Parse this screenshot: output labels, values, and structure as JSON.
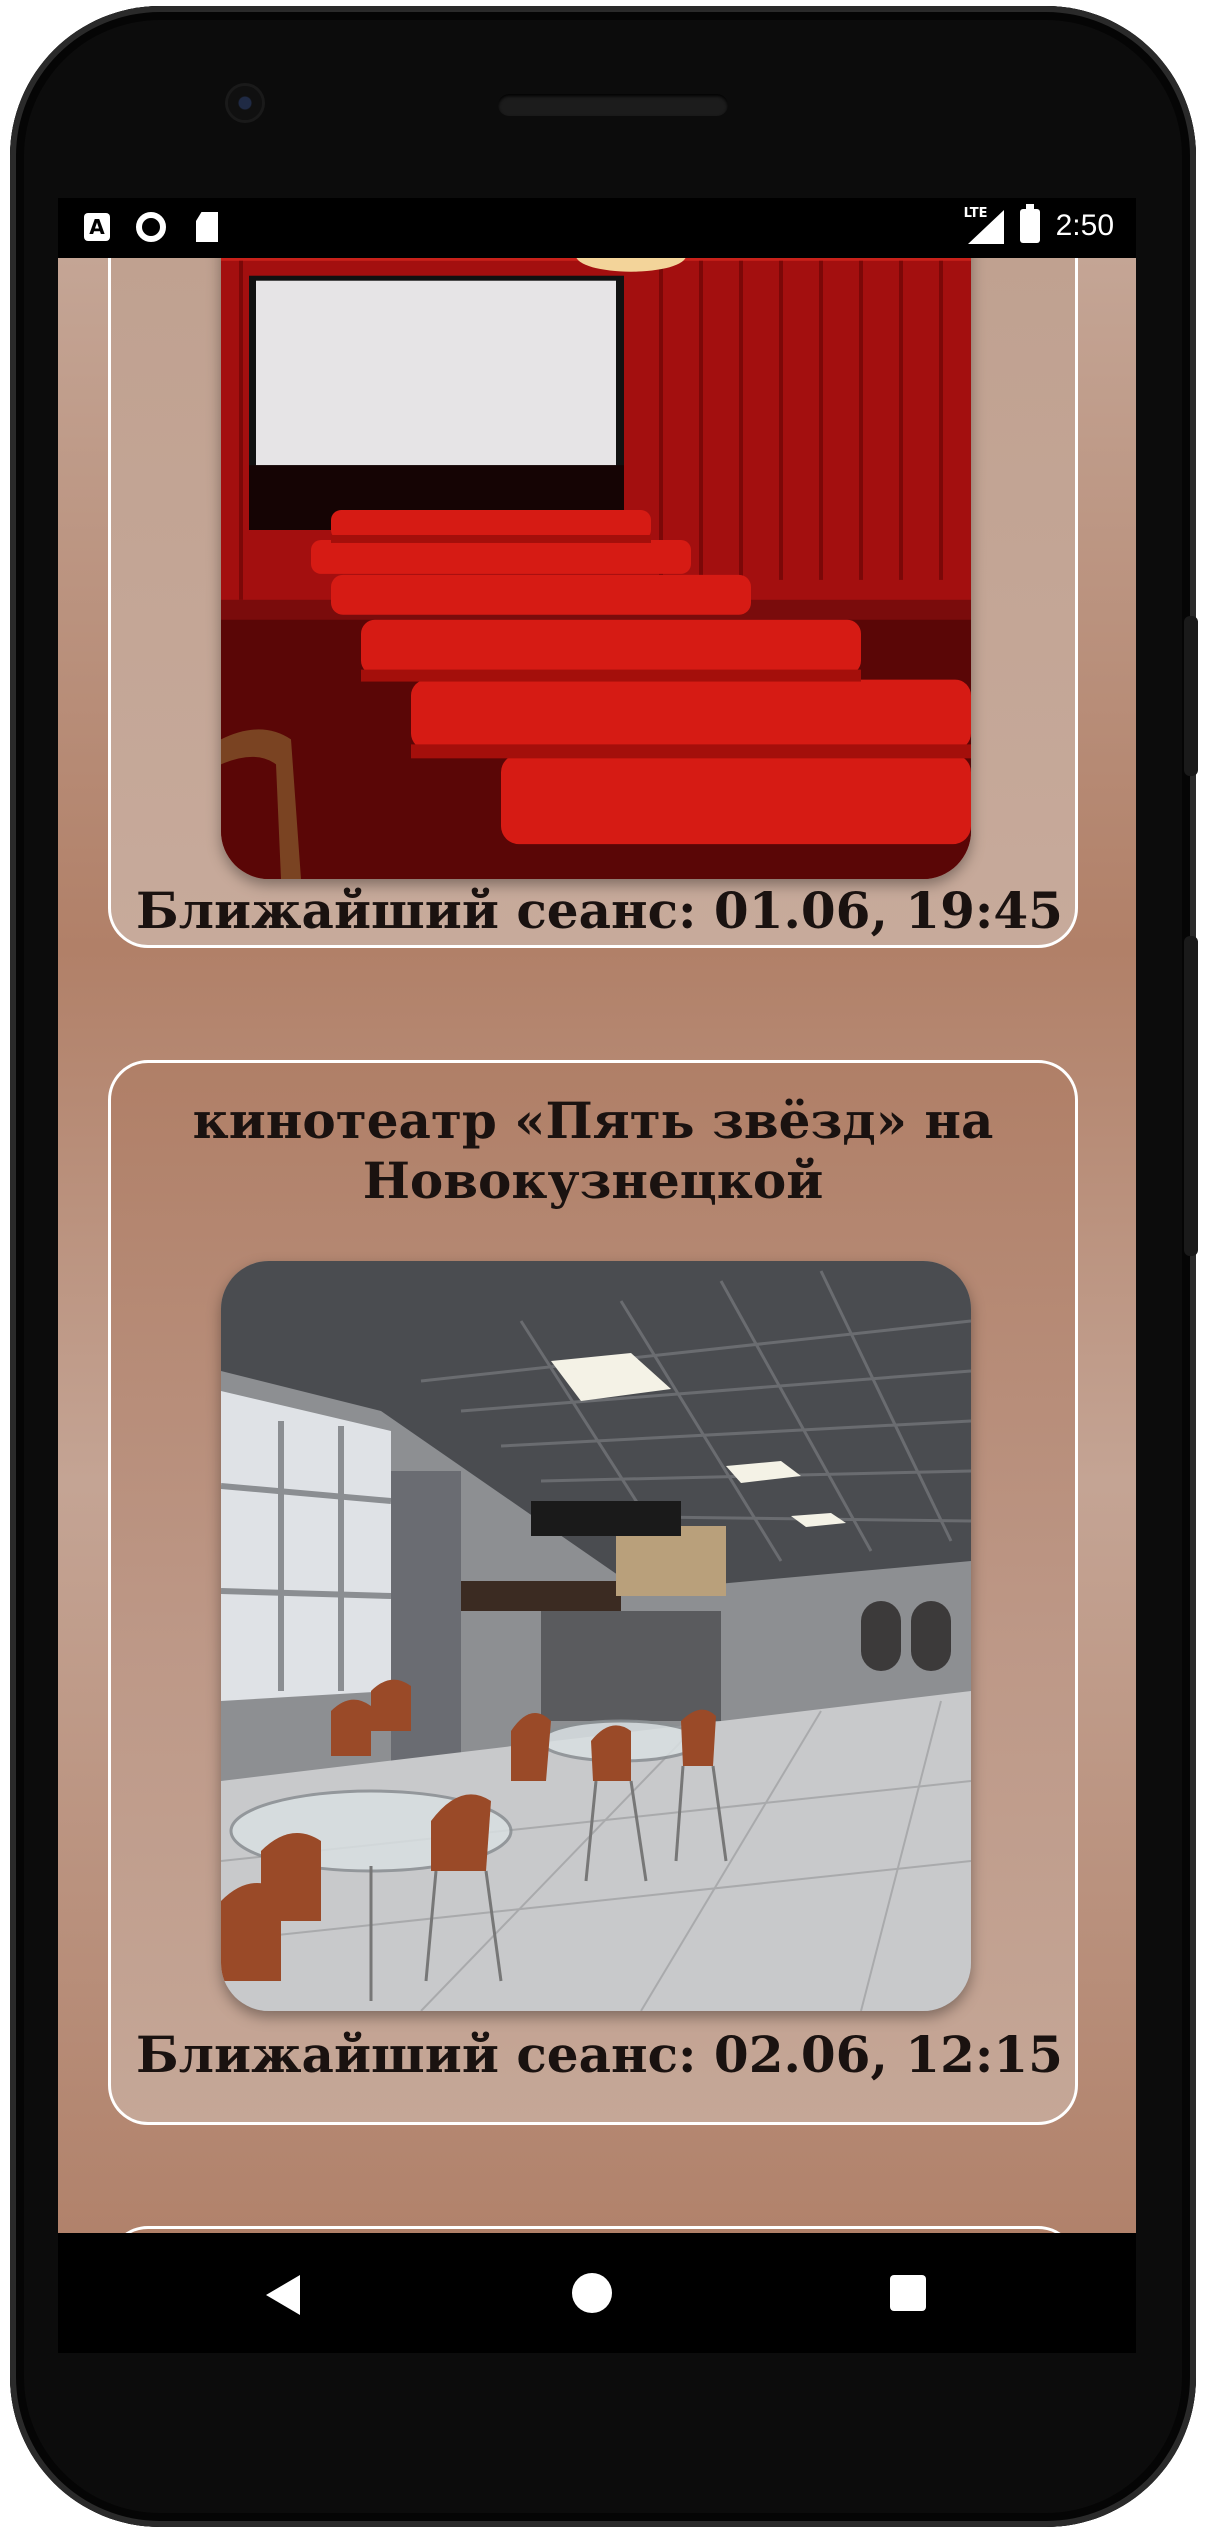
{
  "status_bar": {
    "left_icons": [
      "a-icon",
      "circle-icon",
      "sd-card-icon"
    ],
    "network": "LTE",
    "time": "2:50"
  },
  "cinemas": [
    {
      "title": "",
      "photo": "cinema-hall-red-seats",
      "next_session": "Ближайший сеанс: 01.06, 19:45"
    },
    {
      "title": "кинотеатр «Пять звёзд» на Новокузнецкой",
      "photo": "cinema-lobby-cafe",
      "next_session": "Ближайший сеанс: 02.06, 12:15"
    }
  ],
  "nav_bar": {
    "icons": [
      "back-icon",
      "home-icon",
      "recents-icon"
    ]
  },
  "colors": {
    "background": "#b7896f",
    "card_border": "#ffffff",
    "text": "#1a1210"
  }
}
